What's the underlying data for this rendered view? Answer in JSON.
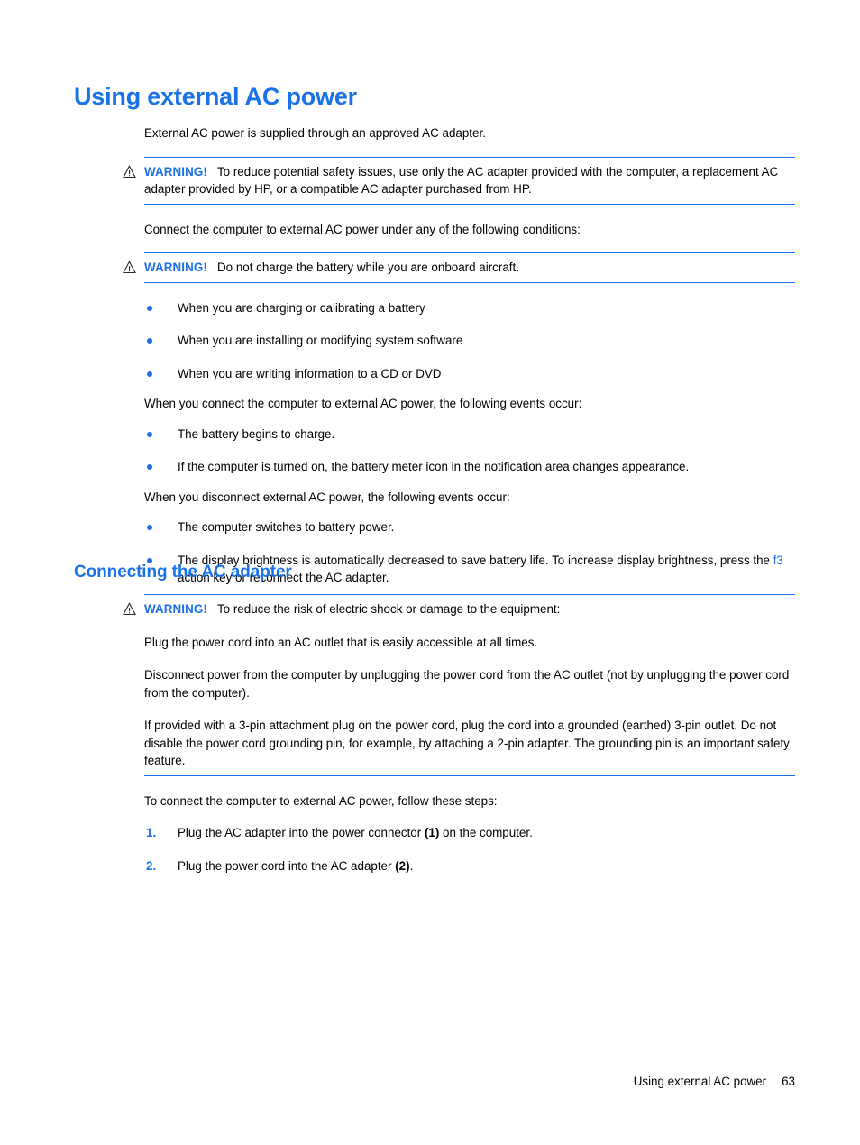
{
  "page": {
    "heading": "Using external AC power",
    "subheading": "Connecting the AC adapter",
    "footer_title": "Using external AC power",
    "footer_page_number": "63"
  },
  "colors": {
    "heading_blue": "#1a72e8",
    "rule_blue": "#1a6fe8",
    "bullet_blue": "#1f6fe0",
    "body_black": "#000000"
  },
  "icons": {
    "warning": "warning-triangle-icon"
  },
  "intro": {
    "paragraph": "External AC power is supplied through an approved AC adapter."
  },
  "warning_1": {
    "label": "WARNING!",
    "text": "To reduce potential safety issues, use only the AC adapter provided with the computer, a replacement AC adapter provided by HP, or a compatible AC adapter purchased from HP."
  },
  "conditions_intro": {
    "paragraph": "Connect the computer to external AC power under any of the following conditions:"
  },
  "warning_2": {
    "label": "WARNING!",
    "text": "Do not charge the battery while you are onboard aircraft."
  },
  "conditions_list": [
    "When you are charging or calibrating a battery",
    "When you are installing or modifying system software",
    "When you are writing information to a CD or DVD"
  ],
  "connect_events": {
    "intro": "When you connect the computer to external AC power, the following events occur:",
    "items": [
      "The battery begins to charge.",
      "If the computer is turned on, the battery meter icon in the notification area changes appearance."
    ]
  },
  "disconnect_events": {
    "intro": "When you disconnect external AC power, the following events occur:",
    "item_1": "The computer switches to battery power.",
    "item_2_before": "The display brightness is automatically decreased to save battery life. To increase display brightness, press the ",
    "item_2_key": "f3",
    "item_2_after": " action key or reconnect the AC adapter."
  },
  "warning_3": {
    "label": "WARNING!",
    "text": "To reduce the risk of electric shock or damage to the equipment:",
    "paragraph_2": "Plug the power cord into an AC outlet that is easily accessible at all times.",
    "paragraph_3": "Disconnect power from the computer by unplugging the power cord from the AC outlet (not by unplugging the power cord from the computer).",
    "paragraph_4": "If provided with a 3-pin attachment plug on the power cord, plug the cord into a grounded (earthed) 3-pin outlet. Do not disable the power cord grounding pin, for example, by attaching a 2-pin adapter. The grounding pin is an important safety feature."
  },
  "steps": {
    "intro": "To connect the computer to external AC power, follow these steps:",
    "items": [
      {
        "number": "1.",
        "before": "Plug the AC adapter into the power connector ",
        "callout": "(1)",
        "after": " on the computer."
      },
      {
        "number": "2.",
        "before": "Plug the power cord into the AC adapter ",
        "callout": "(2)",
        "after": "."
      }
    ]
  }
}
